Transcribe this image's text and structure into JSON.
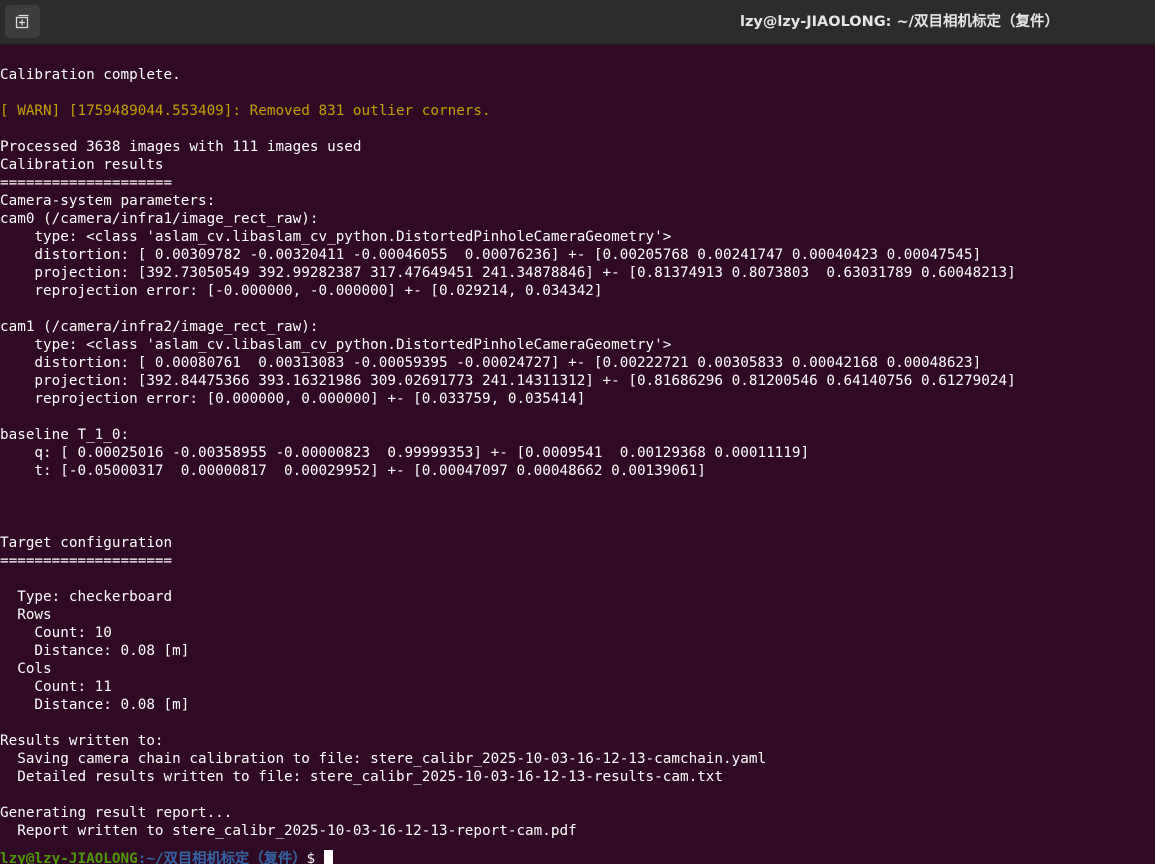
{
  "window": {
    "title": "lzy@lzy-JIAOLONG: ~/双目相机标定（复件）",
    "new_tab_icon": "new-tab-icon"
  },
  "colors": {
    "background": "#300a24",
    "text": "#ffffff",
    "warn": "#c4a000",
    "titlebar": "#2c2c2c"
  },
  "terminal": {
    "lines": [
      "Calibration complete.",
      "[ WARN] [1759489044.553409]: Removed 831 outlier corners.",
      "Processed 3638 images with 111 images used",
      "Calibration results",
      "====================",
      "Camera-system parameters:",
      "cam0 (/camera/infra1/image_rect_raw):",
      "    type: <class 'aslam_cv.libaslam_cv_python.DistortedPinholeCameraGeometry'>",
      "    distortion: [ 0.00309782 -0.00320411 -0.00046055  0.00076236] +- [0.00205768 0.00241747 0.00040423 0.00047545]",
      "    projection: [392.73050549 392.99282387 317.47649451 241.34878846] +- [0.81374913 0.8073803  0.63031789 0.60048213]",
      "    reprojection error: [-0.000000, -0.000000] +- [0.029214, 0.034342]",
      "cam1 (/camera/infra2/image_rect_raw):",
      "    type: <class 'aslam_cv.libaslam_cv_python.DistortedPinholeCameraGeometry'>",
      "    distortion: [ 0.00080761  0.00313083 -0.00059395 -0.00024727] +- [0.00222721 0.00305833 0.00042168 0.00048623]",
      "    projection: [392.84475366 393.16321986 309.02691773 241.14311312] +- [0.81686296 0.81200546 0.64140756 0.61279024]",
      "    reprojection error: [0.000000, 0.000000] +- [0.033759, 0.035414]",
      "baseline T_1_0:",
      "    q: [ 0.00025016 -0.00358955 -0.00000823  0.99999353] +- [0.0009541  0.00129368 0.00011119]",
      "    t: [-0.05000317  0.00000817  0.00029952] +- [0.00047097 0.00048662 0.00139061]",
      "Target configuration",
      "====================",
      "  Type: checkerboard",
      "  Rows",
      "    Count: 10",
      "    Distance: 0.08 [m]",
      "  Cols",
      "    Count: 11",
      "    Distance: 0.08 [m]",
      "Results written to:",
      "  Saving camera chain calibration to file: stere_calibr_2025-10-03-16-12-13-camchain.yaml",
      "  Detailed results written to file: stere_calibr_2025-10-03-16-12-13-results-cam.txt",
      "Generating result report...",
      "  Report written to stere_calibr_2025-10-03-16-12-13-report-cam.pdf"
    ],
    "prompt": {
      "user_host": "lzy@lzy-JIAOLONG",
      "path": ":~/双目相机标定（复件）",
      "symbol": "$ "
    }
  }
}
